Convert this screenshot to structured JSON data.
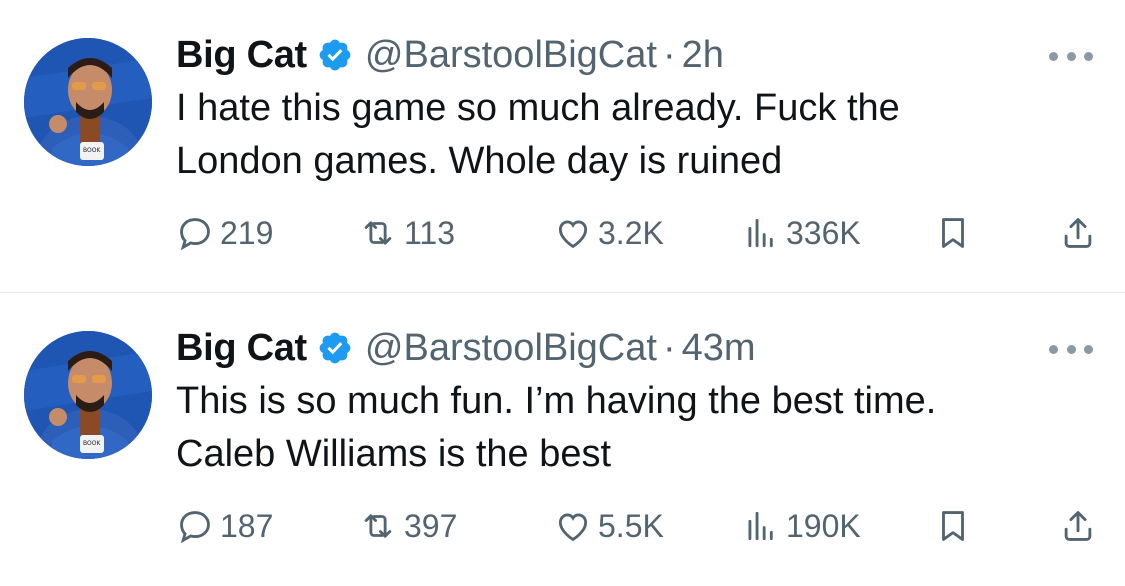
{
  "tweets": [
    {
      "name": "Big Cat",
      "handle": "@BarstoolBigCat",
      "separator": "·",
      "time": "2h",
      "text": "I hate this game so much already. Fuck the\nLondon games. Whole day is ruined",
      "replies": "219",
      "retweets": "113",
      "likes": "3.2K",
      "views": "336K"
    },
    {
      "name": "Big Cat",
      "handle": "@BarstoolBigCat",
      "separator": "·",
      "time": "43m",
      "text": "This is so much fun. I’m having the best time.\nCaleb Williams is the best",
      "replies": "187",
      "retweets": "397",
      "likes": "5.5K",
      "views": "190K"
    }
  ],
  "icons": {
    "verified": "verified-badge-icon",
    "more": "more-icon",
    "reply": "reply-icon",
    "retweet": "retweet-icon",
    "like": "heart-icon",
    "views": "views-icon",
    "bookmark": "bookmark-icon",
    "share": "share-icon"
  },
  "colors": {
    "verified_blue": "#1d9bf0",
    "text_primary": "#0f1419",
    "text_secondary": "#536471",
    "divider": "#e6e9eb"
  }
}
